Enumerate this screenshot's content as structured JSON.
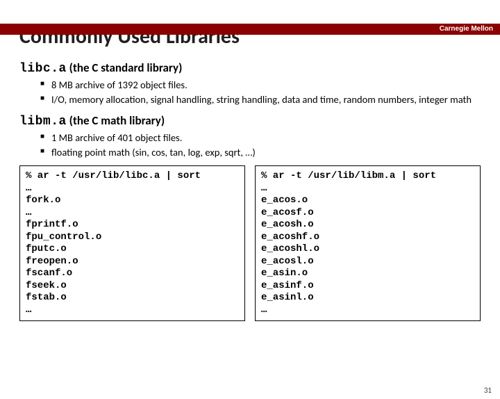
{
  "brand": "Carnegie Mellon",
  "title": "Commonly Used Libraries",
  "sections": [
    {
      "lib_name": "libc.a",
      "lib_desc": " (the C standard library)",
      "bullets": [
        "8 MB archive of 1392 object files.",
        "I/O, memory allocation, signal handling, string handling, data and time, random numbers, integer math"
      ]
    },
    {
      "lib_name": "libm.a",
      "lib_desc": " (the C math library)",
      "bullets": [
        "1 MB archive of 401 object files.",
        "floating point math (sin, cos, tan, log, exp, sqrt, …)"
      ]
    }
  ],
  "code_left": "% ar -t /usr/lib/libc.a | sort\n…\nfork.o\n…\nfprintf.o\nfpu_control.o\nfputc.o\nfreopen.o\nfscanf.o\nfseek.o\nfstab.o\n…",
  "code_right": "% ar -t /usr/lib/libm.a | sort\n…\ne_acos.o\ne_acosf.o\ne_acosh.o\ne_acoshf.o\ne_acoshl.o\ne_acosl.o\ne_asin.o\ne_asinf.o\ne_asinl.o\n…",
  "slide_number": "31"
}
